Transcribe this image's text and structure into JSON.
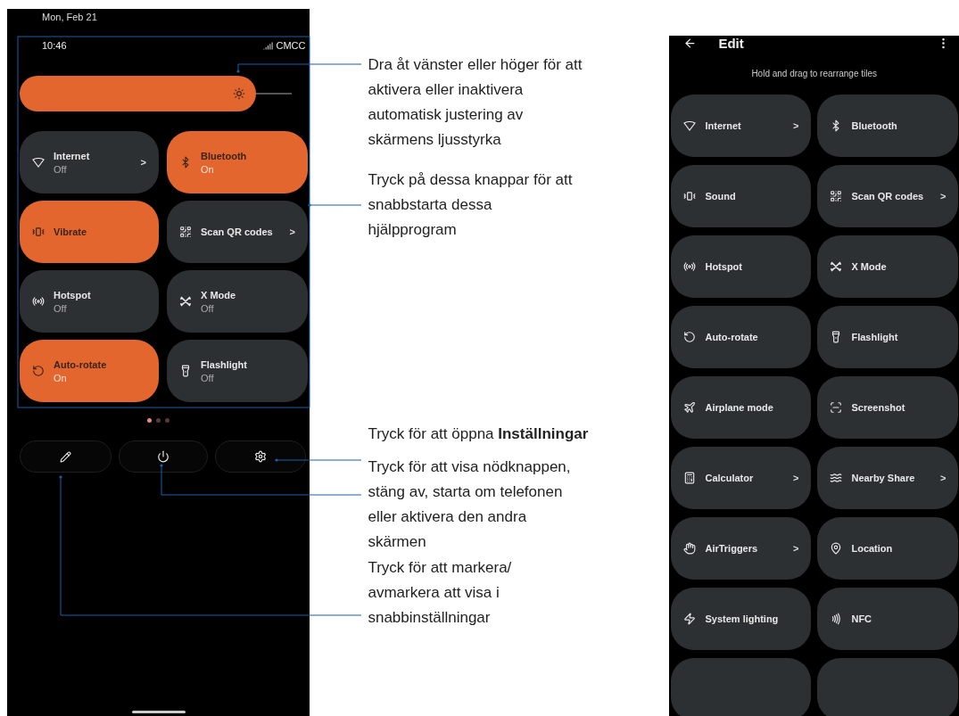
{
  "quick_settings": {
    "date": "Mon, Feb 21",
    "time": "10:46",
    "carrier": "CMCC",
    "brightness": {
      "level": 0.87
    },
    "tiles": [
      {
        "label": "Internet",
        "status": "Off",
        "on": false,
        "chevron": ">"
      },
      {
        "label": "Bluetooth",
        "status": "On",
        "on": true
      },
      {
        "label": "Vibrate",
        "on": true
      },
      {
        "label": "Scan QR codes",
        "on": false,
        "chevron": ">"
      },
      {
        "label": "Hotspot",
        "status": "Off",
        "on": false
      },
      {
        "label": "X Mode",
        "status": "Off",
        "on": false
      },
      {
        "label": "Auto-rotate",
        "status": "On",
        "on": true
      },
      {
        "label": "Flashlight",
        "status": "Off",
        "on": false
      }
    ],
    "page_dots": [
      {
        "selected": true
      },
      {
        "selected": false
      },
      {
        "selected": false
      }
    ]
  },
  "annotations": [
    "Dra åt vänster eller höger för att aktivera eller inaktivera automatisk justering av skärmens ljusstyrka",
    "Tryck på dessa knappar för att snabbstarta dessa hjälpprogram",
    "Tryck för att öppna **Inställningar**",
    "Tryck för att visa nödknappen, stäng av, starta om telefonen eller aktivera den andra skärmen",
    "Tryck för att markera/ avmarkera att visa i snabbinställningar"
  ],
  "edit_screen": {
    "title": "Edit",
    "hint": "Hold and drag to rearrange tiles",
    "tiles": [
      {
        "label": "Internet",
        "chevron": ">"
      },
      {
        "label": "Bluetooth"
      },
      {
        "label": "Sound"
      },
      {
        "label": "Scan QR codes",
        "chevron": ">"
      },
      {
        "label": "Hotspot"
      },
      {
        "label": "X Mode"
      },
      {
        "label": "Auto-rotate"
      },
      {
        "label": "Flashlight"
      },
      {
        "label": "Airplane mode"
      },
      {
        "label": "Screenshot"
      },
      {
        "label": "Calculator",
        "chevron": ">"
      },
      {
        "label": "Nearby Share",
        "chevron": ">"
      },
      {
        "label": "AirTriggers",
        "chevron": ">"
      },
      {
        "label": "Location"
      },
      {
        "label": "System lighting"
      },
      {
        "label": "NFC"
      }
    ]
  }
}
